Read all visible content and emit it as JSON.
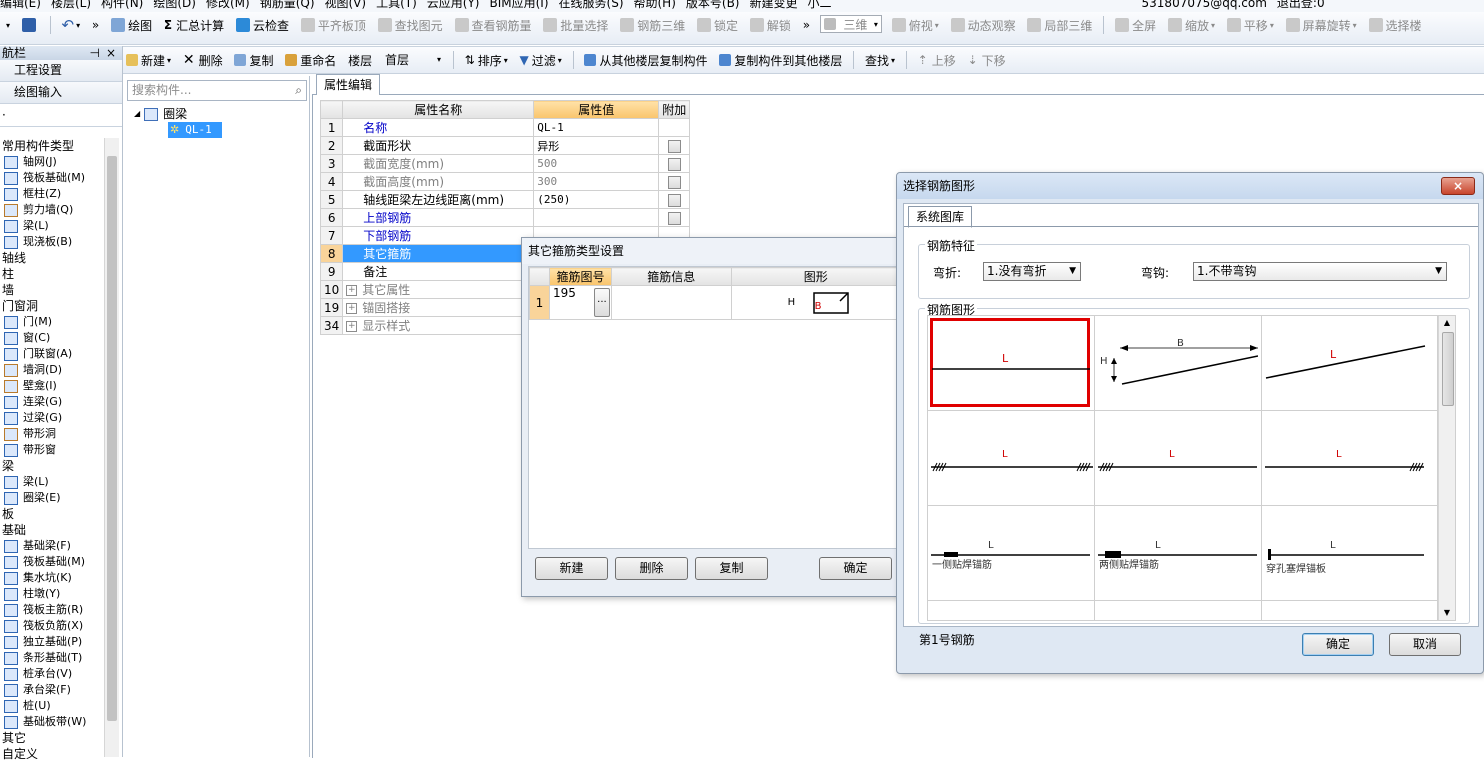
{
  "menubar": [
    "编辑(E)",
    "楼层(L)",
    "构件(N)",
    "绘图(D)",
    "修改(M)",
    "钢筋量(Q)",
    "视图(V)",
    "工具(T)",
    "云应用(Y)",
    "BIM应用(I)",
    "在线服务(S)",
    "帮助(H)",
    "版本号(B)",
    "新建变更",
    "小二",
    "531807075@qq.com",
    "退出登:0"
  ],
  "toolbar1": {
    "draw": "绘图",
    "sum": "汇总计算",
    "cloud_check": "云检查",
    "flat_top": "平齐板顶",
    "find_elem": "查找图元",
    "view_rebar": "查看钢筋量",
    "batch_select": "批量选择",
    "rebar_3d": "钢筋三维",
    "lock": "锁定",
    "unlock": "解锁",
    "view_mode": "三维",
    "top_view": "俯视",
    "dynamic_view": "动态观察",
    "local_3d": "局部三维",
    "fullscreen": "全屏",
    "zoom": "缩放",
    "pan": "平移",
    "rotate": "屏幕旋转",
    "select_floor": "选择楼"
  },
  "toolbar2": {
    "new": "新建",
    "delete": "删除",
    "copy": "复制",
    "rename": "重命名",
    "floor_label": "楼层",
    "floor_value": "首层",
    "sort": "排序",
    "filter": "过滤",
    "copy_from_floor": "从其他楼层复制构件",
    "copy_to_floor": "复制构件到其他楼层",
    "find": "查找",
    "move_up": "上移",
    "move_down": "下移"
  },
  "left_panel": {
    "title": "航栏",
    "buttons": [
      "工程设置",
      "绘图输入"
    ],
    "items": [
      {
        "label": "常用构件类型",
        "kind": "cat"
      },
      {
        "label": "轴网(J)",
        "kind": "child",
        "color": "#2f66b3"
      },
      {
        "label": "筏板基础(M)",
        "kind": "child",
        "color": "#2f66b3"
      },
      {
        "label": "框柱(Z)",
        "kind": "child",
        "color": "#2f66b3"
      },
      {
        "label": "剪力墙(Q)",
        "kind": "child",
        "color": "#b87a2c"
      },
      {
        "label": "梁(L)",
        "kind": "child",
        "color": "#2f66b3"
      },
      {
        "label": "现浇板(B)",
        "kind": "child",
        "color": "#2f66b3"
      },
      {
        "label": "轴线",
        "kind": "cat"
      },
      {
        "label": "柱",
        "kind": "cat"
      },
      {
        "label": "墙",
        "kind": "cat"
      },
      {
        "label": "门窗洞",
        "kind": "cat"
      },
      {
        "label": "门(M)",
        "kind": "child",
        "color": "#2f66b3"
      },
      {
        "label": "窗(C)",
        "kind": "child",
        "color": "#2f66b3"
      },
      {
        "label": "门联窗(A)",
        "kind": "child",
        "color": "#2f66b3"
      },
      {
        "label": "墙洞(D)",
        "kind": "child",
        "color": "#b87a2c"
      },
      {
        "label": "壁龛(I)",
        "kind": "child",
        "color": "#b87a2c"
      },
      {
        "label": "连梁(G)",
        "kind": "child",
        "color": "#2f66b3"
      },
      {
        "label": "过梁(G)",
        "kind": "child",
        "color": "#2f66b3"
      },
      {
        "label": "带形洞",
        "kind": "child",
        "color": "#b87a2c"
      },
      {
        "label": "带形窗",
        "kind": "child",
        "color": "#2f66b3"
      },
      {
        "label": "梁",
        "kind": "cat"
      },
      {
        "label": "梁(L)",
        "kind": "child",
        "color": "#2f66b3"
      },
      {
        "label": "圈梁(E)",
        "kind": "child",
        "color": "#2f66b3"
      },
      {
        "label": "板",
        "kind": "cat"
      },
      {
        "label": "基础",
        "kind": "cat"
      },
      {
        "label": "基础梁(F)",
        "kind": "child",
        "color": "#2f66b3"
      },
      {
        "label": "筏板基础(M)",
        "kind": "child",
        "color": "#2f66b3"
      },
      {
        "label": "集水坑(K)",
        "kind": "child",
        "color": "#2f66b3"
      },
      {
        "label": "柱墩(Y)",
        "kind": "child",
        "color": "#2f66b3"
      },
      {
        "label": "筏板主筋(R)",
        "kind": "child",
        "color": "#2f66b3"
      },
      {
        "label": "筏板负筋(X)",
        "kind": "child",
        "color": "#2f66b3"
      },
      {
        "label": "独立基础(P)",
        "kind": "child",
        "color": "#2f66b3"
      },
      {
        "label": "条形基础(T)",
        "kind": "child",
        "color": "#2f66b3"
      },
      {
        "label": "桩承台(V)",
        "kind": "child",
        "color": "#2f66b3"
      },
      {
        "label": "承台梁(F)",
        "kind": "child",
        "color": "#2f66b3"
      },
      {
        "label": "桩(U)",
        "kind": "child",
        "color": "#2f66b3"
      },
      {
        "label": "基础板带(W)",
        "kind": "child",
        "color": "#2f66b3"
      },
      {
        "label": "其它",
        "kind": "cat"
      },
      {
        "label": "自定义",
        "kind": "cat"
      }
    ]
  },
  "mid_panel": {
    "search_placeholder": "搜索构件...",
    "tree_root": "圈梁",
    "tree_child": "QL-1"
  },
  "props": {
    "tab": "属性编辑",
    "headers": [
      "属性名称",
      "属性值",
      "附加"
    ],
    "rows": [
      {
        "n": "1",
        "name": "名称",
        "value": "QL-1",
        "style": "blue",
        "chk": false
      },
      {
        "n": "2",
        "name": "截面形状",
        "value": "异形",
        "style": "",
        "chk": true
      },
      {
        "n": "3",
        "name": "截面宽度(mm)",
        "value": "500",
        "style": "gray",
        "chk": true
      },
      {
        "n": "4",
        "name": "截面高度(mm)",
        "value": "300",
        "style": "gray",
        "chk": true
      },
      {
        "n": "5",
        "name": "轴线距梁左边线距离(mm)",
        "value": "(250)",
        "style": "",
        "chk": true
      },
      {
        "n": "6",
        "name": "上部钢筋",
        "value": "",
        "style": "blue",
        "chk": true
      },
      {
        "n": "7",
        "name": "下部钢筋",
        "value": "",
        "style": "blue",
        "chk": false
      },
      {
        "n": "8",
        "name": "其它箍筋",
        "value": "",
        "style": "sel",
        "chk": false
      },
      {
        "n": "9",
        "name": "备注",
        "value": "",
        "style": "",
        "chk": false
      },
      {
        "n": "10",
        "name": "其它属性",
        "value": "",
        "style": "gray",
        "plus": true
      },
      {
        "n": "19",
        "name": "锚固搭接",
        "value": "",
        "style": "gray",
        "plus": true
      },
      {
        "n": "34",
        "name": "显示样式",
        "value": "",
        "style": "gray",
        "plus": true
      }
    ]
  },
  "stirrup_dialog": {
    "title": "其它箍筋类型设置",
    "headers": [
      "箍筋图号",
      "箍筋信息",
      "图形"
    ],
    "row_num": "1",
    "shape_no": "195",
    "ellipsis": "...",
    "shape_label_h": "H",
    "shape_label_b": "B",
    "btn_new": "新建",
    "btn_delete": "删除",
    "btn_copy": "复制",
    "btn_ok": "确定"
  },
  "rebar_dialog": {
    "title": "选择钢筋图形",
    "close": "×",
    "tab": "系统图库",
    "features_label": "钢筋特征",
    "bend_label": "弯折:",
    "bend_value": "1.没有弯折",
    "hook_label": "弯钩:",
    "hook_value": "1.不带弯钩",
    "shapes_label": "钢筋图形",
    "shape_texts": {
      "L": "L",
      "B": "B",
      "H": "H",
      "one_side": "一侧贴焊锚筋",
      "two_side": "两侧贴焊锚筋",
      "through": "穿孔塞焊锚板"
    },
    "status": "第1号钢筋",
    "btn_ok": "确定",
    "btn_cancel": "取消"
  },
  "colors": {
    "selection": "#3399ff",
    "header_highlight": "#f9c46c",
    "red_border": "#e00000",
    "link_blue": "#0000c8"
  }
}
